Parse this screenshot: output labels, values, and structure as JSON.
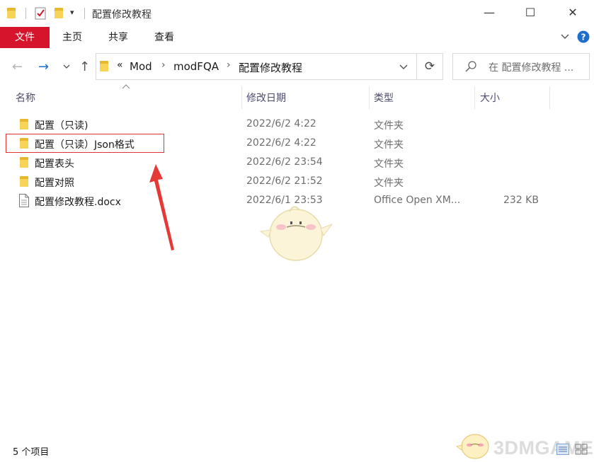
{
  "window": {
    "title": "配置修改教程",
    "controls": {
      "minimize": "—",
      "maximize": "☐",
      "close": "✕"
    }
  },
  "ribbon": {
    "tabs": [
      "文件",
      "主页",
      "共享",
      "查看"
    ],
    "expand_icon": "chevron-down-icon",
    "help_icon": "help-icon"
  },
  "nav": {
    "breadcrumb": [
      "«",
      "Mod",
      "modFQA",
      "配置修改教程"
    ],
    "search_placeholder": "在 配置修改教程 ..."
  },
  "columns": {
    "name": "名称",
    "date": "修改日期",
    "type": "类型",
    "size": "大小"
  },
  "files": [
    {
      "name": "配置（只读)",
      "date": "2022/6/2 4:22",
      "type": "文件夹",
      "size": "",
      "icon": "folder-icon"
    },
    {
      "name": "配置（只读）Json格式",
      "date": "2022/6/2 4:22",
      "type": "文件夹",
      "size": "",
      "icon": "folder-icon",
      "highlighted": true
    },
    {
      "name": "配置表头",
      "date": "2022/6/2 23:54",
      "type": "文件夹",
      "size": "",
      "icon": "folder-icon"
    },
    {
      "name": "配置对照",
      "date": "2022/6/2 21:52",
      "type": "文件夹",
      "size": "",
      "icon": "folder-icon"
    },
    {
      "name": "配置修改教程.docx",
      "date": "2022/6/1 23:53",
      "type": "Office Open XM...",
      "size": "232 KB",
      "icon": "document-icon"
    }
  ],
  "status": {
    "item_count": "5 个项目"
  },
  "watermark": {
    "text": "3DMGAME"
  },
  "colors": {
    "file_tab": "#d6152c",
    "highlight_box": "#e03434",
    "arrow": "#e53935",
    "folder": "#f7d358"
  }
}
